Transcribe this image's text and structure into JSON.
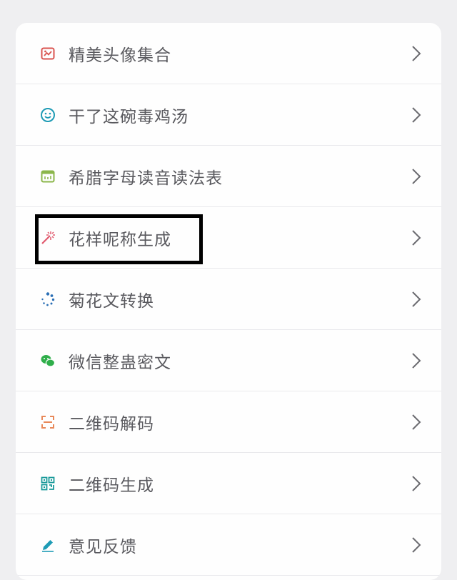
{
  "menu": {
    "items": [
      {
        "label": "精美头像集合",
        "icon": "avatar-image-icon",
        "icon_color": "#d9534f"
      },
      {
        "label": "干了这碗毒鸡汤",
        "icon": "smiley-icon",
        "icon_color": "#1e9bb5"
      },
      {
        "label": "希腊字母读音读法表",
        "icon": "table-icon",
        "icon_color": "#8bb64a"
      },
      {
        "label": "花样呢称生成",
        "icon": "magic-wand-icon",
        "icon_color": "#e05a6e"
      },
      {
        "label": "菊花文转换",
        "icon": "spinner-icon",
        "icon_color": "#2b6fb5"
      },
      {
        "label": "微信整蛊密文",
        "icon": "wechat-icon",
        "icon_color": "#2fae4a"
      },
      {
        "label": "二维码解码",
        "icon": "scan-icon",
        "icon_color": "#e8895a"
      },
      {
        "label": "二维码生成",
        "icon": "qrcode-icon",
        "icon_color": "#1a9a9a"
      },
      {
        "label": "意见反馈",
        "icon": "pencil-icon",
        "icon_color": "#1e9bb5"
      }
    ]
  }
}
